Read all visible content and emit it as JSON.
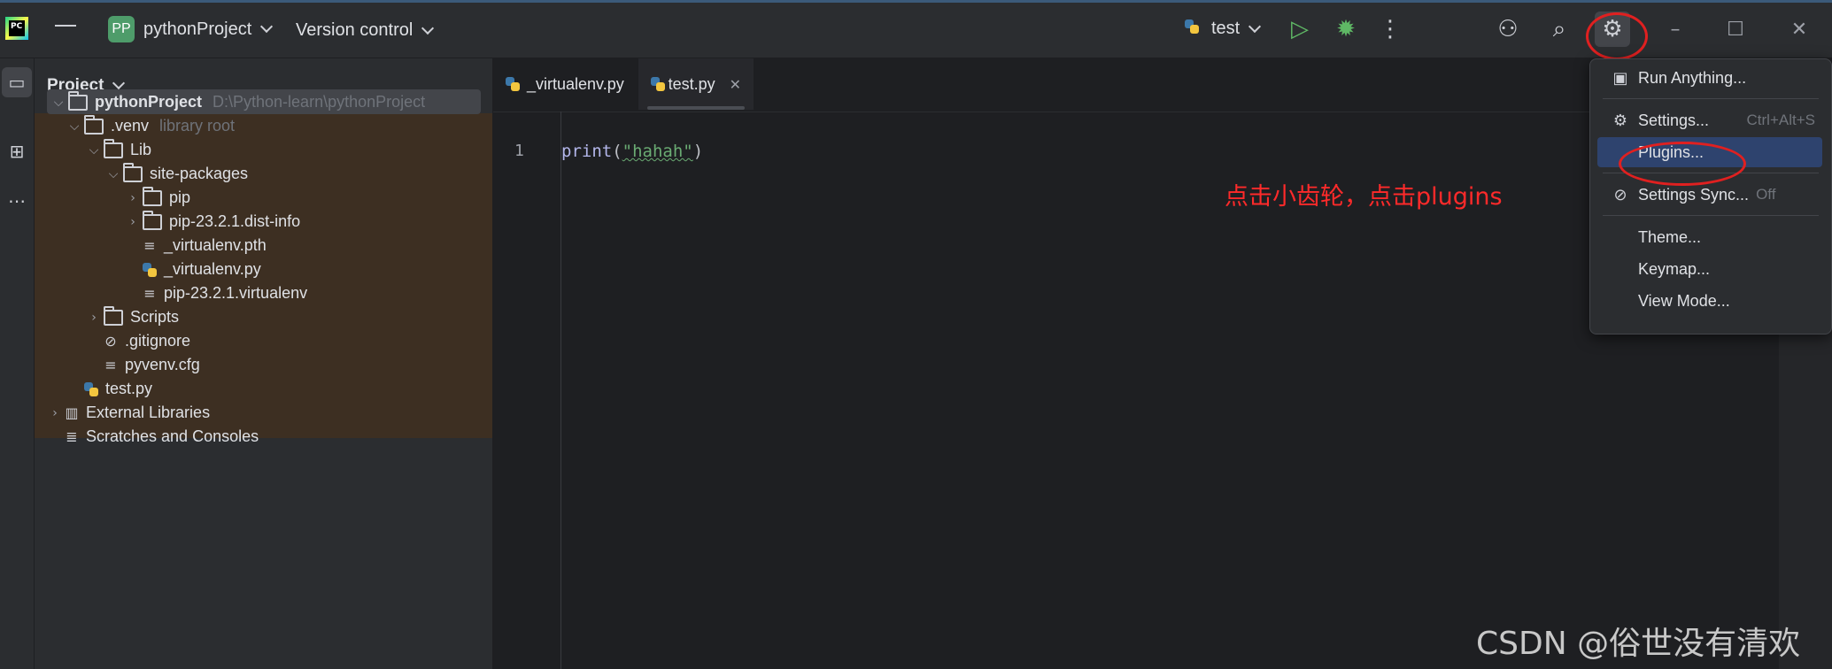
{
  "titlebar": {
    "project_badge": "PP",
    "project_name": "pythonProject",
    "vcs_label": "Version control",
    "run_config": "test"
  },
  "icons": {
    "hamburger": "hamburger-menu-icon",
    "run": "run-icon",
    "debug": "debug-icon",
    "more": "more-vertical-icon",
    "add_user": "add-user-icon",
    "search": "search-icon",
    "settings": "gear-icon",
    "minimize": "minimize-icon",
    "maximize": "maximize-icon",
    "close": "close-icon"
  },
  "project_panel": {
    "title": "Project",
    "tree": [
      {
        "name": "pythonProject",
        "hint": "D:\\Python-learn\\pythonProject"
      },
      {
        "name": ".venv",
        "hint": "library root"
      },
      {
        "name": "Lib"
      },
      {
        "name": "site-packages"
      },
      {
        "name": "pip"
      },
      {
        "name": "pip-23.2.1.dist-info"
      },
      {
        "name": "_virtualenv.pth"
      },
      {
        "name": "_virtualenv.py"
      },
      {
        "name": "pip-23.2.1.virtualenv"
      },
      {
        "name": "Scripts"
      },
      {
        "name": ".gitignore"
      },
      {
        "name": "pyvenv.cfg"
      },
      {
        "name": "test.py"
      },
      {
        "name": "External Libraries"
      },
      {
        "name": "Scratches and Consoles"
      }
    ]
  },
  "editor": {
    "tabs": [
      {
        "label": "_virtualenv.py"
      },
      {
        "label": "test.py"
      }
    ],
    "line_number": "1",
    "code": {
      "fn": "print",
      "open": "(",
      "string": "\"hahah\"",
      "close": ")"
    },
    "annotation": "点击小齿轮，点击plugins"
  },
  "settings_menu": {
    "items": [
      {
        "label": "Run Anything...",
        "shortcut": ""
      },
      {
        "label": "Settings...",
        "shortcut": "Ctrl+Alt+S"
      },
      {
        "label": "Plugins...",
        "shortcut": ""
      },
      {
        "label": "Settings Sync...",
        "shortcut": "Off"
      },
      {
        "label": "Theme...",
        "shortcut": ""
      },
      {
        "label": "Keymap...",
        "shortcut": ""
      },
      {
        "label": "View Mode...",
        "shortcut": ""
      }
    ]
  },
  "watermark": "CSDN @俗世没有清欢",
  "colors": {
    "accent_selected": "#2e436e",
    "annotation_red": "#ff2a2a",
    "library_root_bg": "#3d2f22"
  }
}
